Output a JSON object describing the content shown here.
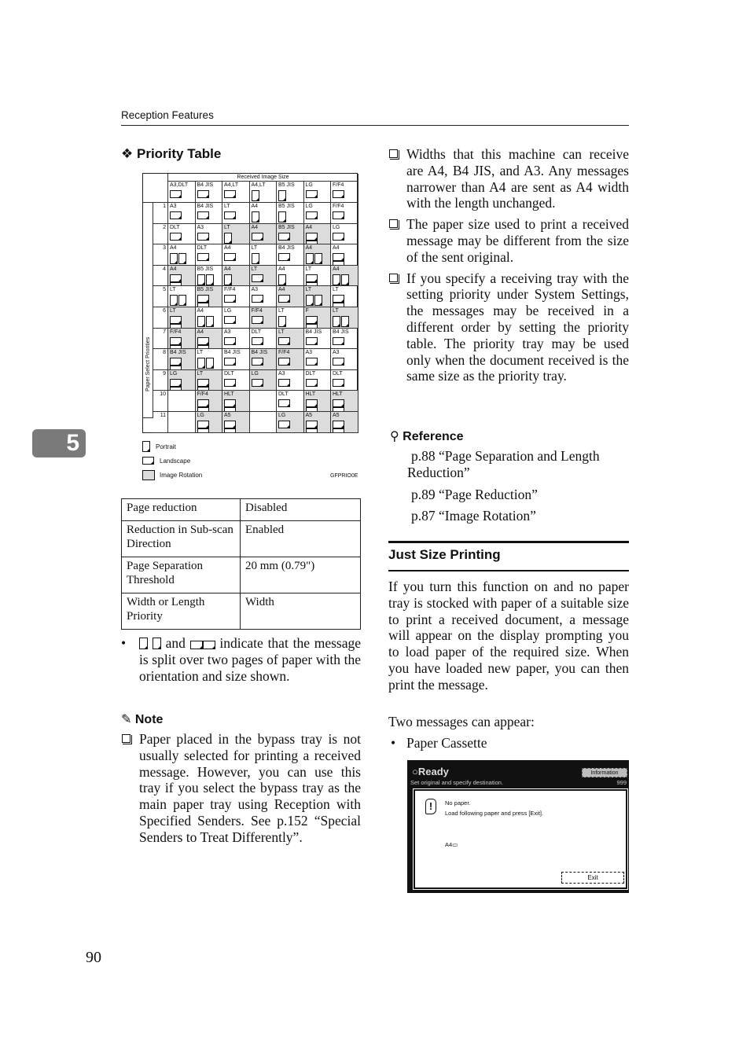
{
  "header": {
    "section_title": "Reception Features"
  },
  "chapter_tab": "5",
  "page_number": "90",
  "priority_table": {
    "heading": "Priority Table",
    "received_image_size_label": "Received Image Size",
    "paper_select_priorities_label": "Paper Select Priorities",
    "columns": [
      "A3,DLT",
      "B4 JIS",
      "A4,LT",
      "A4,LT",
      "B5 JIS",
      "LG",
      "F/F4"
    ],
    "column_icons": [
      "land",
      "land",
      "land",
      "port",
      "port",
      "land",
      "land"
    ],
    "rows": [
      {
        "num": "1",
        "cells": [
          [
            "A3",
            "land",
            1,
            0
          ],
          [
            "B4 JIS",
            "land",
            1,
            0
          ],
          [
            "LT",
            "land",
            1,
            0
          ],
          [
            "A4",
            "port",
            1,
            0
          ],
          [
            "B5 JIS",
            "port",
            1,
            0
          ],
          [
            "LG",
            "land",
            1,
            0
          ],
          [
            "F/F4",
            "land",
            1,
            0
          ]
        ]
      },
      {
        "num": "2",
        "cells": [
          [
            "DLT",
            "land",
            1,
            0
          ],
          [
            "A3",
            "land",
            1,
            0
          ],
          [
            "LT",
            "port",
            1,
            1
          ],
          [
            "A4",
            "land",
            1,
            1
          ],
          [
            "B5 JIS",
            "land",
            1,
            1
          ],
          [
            "A4",
            "land",
            2,
            1
          ],
          [
            "LG",
            "land",
            1,
            0
          ]
        ]
      },
      {
        "num": "3",
        "cells": [
          [
            "A4",
            "port",
            2,
            0
          ],
          [
            "DLT",
            "land",
            1,
            0
          ],
          [
            "A4",
            "land",
            1,
            0
          ],
          [
            "LT",
            "port",
            1,
            0
          ],
          [
            "B4 JIS",
            "land",
            1,
            0
          ],
          [
            "A4",
            "port",
            2,
            1
          ],
          [
            "A4",
            "land",
            2,
            0
          ]
        ]
      },
      {
        "num": "4",
        "cells": [
          [
            "A4",
            "land",
            2,
            1
          ],
          [
            "B5 JIS",
            "port",
            2,
            0
          ],
          [
            "A4",
            "port",
            1,
            1
          ],
          [
            "LT",
            "land",
            1,
            1
          ],
          [
            "A4",
            "port",
            1,
            0
          ],
          [
            "LT",
            "land",
            2,
            0
          ],
          [
            "A4",
            "port",
            2,
            1
          ]
        ]
      },
      {
        "num": "5",
        "cells": [
          [
            "LT",
            "port",
            2,
            0
          ],
          [
            "B5 JIS",
            "land",
            2,
            1
          ],
          [
            "F/F4",
            "land",
            1,
            0
          ],
          [
            "A3",
            "land",
            1,
            0
          ],
          [
            "A4",
            "land",
            1,
            1
          ],
          [
            "LT",
            "port",
            2,
            1
          ],
          [
            "LT",
            "land",
            2,
            0
          ]
        ]
      },
      {
        "num": "6",
        "cells": [
          [
            "LT",
            "land",
            2,
            1
          ],
          [
            "A4",
            "port",
            2,
            0
          ],
          [
            "LG",
            "land",
            1,
            0
          ],
          [
            "F/F4",
            "land",
            1,
            1
          ],
          [
            "LT",
            "port",
            1,
            0
          ],
          [
            "F",
            "land",
            2,
            1
          ],
          [
            "LT",
            "port",
            2,
            1
          ]
        ]
      },
      {
        "num": "7",
        "cells": [
          [
            "F/F4",
            "land",
            2,
            1
          ],
          [
            "A4",
            "land",
            2,
            1
          ],
          [
            "A3",
            "land",
            1,
            0
          ],
          [
            "DLT",
            "land",
            1,
            0
          ],
          [
            "LT",
            "land",
            1,
            1
          ],
          [
            "B4 JIS",
            "land",
            1,
            0
          ],
          [
            "B4 JIS",
            "land",
            1,
            0
          ]
        ]
      },
      {
        "num": "8",
        "cells": [
          [
            "B4 JIS",
            "land",
            2,
            1
          ],
          [
            "LT",
            "port",
            2,
            0
          ],
          [
            "B4 JIS",
            "land",
            1,
            0
          ],
          [
            "B4 JIS",
            "land",
            1,
            1
          ],
          [
            "F/F4",
            "land",
            1,
            1
          ],
          [
            "A3",
            "land",
            1,
            0
          ],
          [
            "A3",
            "land",
            1,
            0
          ]
        ]
      },
      {
        "num": "9",
        "cells": [
          [
            "LG",
            "land",
            2,
            1
          ],
          [
            "LT",
            "land",
            2,
            1
          ],
          [
            "DLT",
            "land",
            1,
            0
          ],
          [
            "LG",
            "land",
            1,
            1
          ],
          [
            "A3",
            "land",
            1,
            0
          ],
          [
            "DLT",
            "land",
            1,
            0
          ],
          [
            "DLT",
            "land",
            1,
            0
          ]
        ]
      },
      {
        "num": "10",
        "cells": [
          [
            "",
            "none",
            0,
            0
          ],
          [
            "F/F4",
            "land",
            2,
            1
          ],
          [
            "HLT",
            "land",
            2,
            1
          ],
          [
            "",
            "none",
            0,
            0
          ],
          [
            "DLT",
            "land",
            1,
            0
          ],
          [
            "HLT",
            "land",
            2,
            1
          ],
          [
            "HLT",
            "land",
            2,
            1
          ]
        ]
      },
      {
        "num": "11",
        "cells": [
          [
            "",
            "none",
            0,
            0
          ],
          [
            "LG",
            "land",
            2,
            1
          ],
          [
            "A5",
            "land",
            2,
            1
          ],
          [
            "",
            "none",
            0,
            0
          ],
          [
            "LG",
            "land",
            1,
            1
          ],
          [
            "A5",
            "land",
            2,
            1
          ],
          [
            "A5",
            "land",
            2,
            1
          ]
        ]
      }
    ],
    "legend": {
      "portrait": "Portrait",
      "landscape": "Landscape",
      "image_rotation": "Image Rotation"
    },
    "figure_id": "GFPRIO0E"
  },
  "settings_table": [
    {
      "setting": "Page reduction",
      "value": "Disabled"
    },
    {
      "setting": "Reduction in Sub-scan Direction",
      "value": "Enabled"
    },
    {
      "setting": "Page Separation Threshold",
      "value": "20 mm (0.79\")"
    },
    {
      "setting": "Width or Length Priority",
      "value": "Width"
    }
  ],
  "split_note": {
    "and": "and",
    "text": "indicate that the message is split over two pages of paper with the orientation and size shown."
  },
  "note": {
    "heading": "Note",
    "items": [
      "Paper placed in the bypass tray is not usually selected for printing a received message. However, you can use this tray if you select the bypass tray as the main paper tray using Reception with Specified Senders. See p.152 “Special Senders to Treat Differently”."
    ]
  },
  "right_notes": [
    "Widths that this machine can receive are A4, B4 JIS, and A3. Any messages narrower than A4 are sent as A4 width with the length unchanged.",
    "The paper size used to print a received message may be different from the size of the sent original.",
    "If you specify a receiving tray with the setting priority under System Settings, the messages may be received in a different order by setting the priority table. The priority tray may be used only when the document received is the same size as the priority tray."
  ],
  "reference": {
    "heading": "Reference",
    "links": [
      "p.88 “Page Separation and Length Reduction”",
      "p.89 “Page Reduction”",
      "p.87 “Image Rotation”"
    ]
  },
  "just_size_printing": {
    "heading": "Just Size Printing",
    "body": "If you turn this function on and no paper tray is stocked with paper of a suitable size to print a received document, a message will appear on the display prompting you to load paper of the required size. When you have loaded new paper, you can then print the message.",
    "two_messages": "Two messages can appear:",
    "bullet": "Paper Cassette"
  },
  "device_screen": {
    "status": "○Ready",
    "info_button": "Information",
    "subtitle": "Set original and specify destination.",
    "count": "999",
    "line1": "No paper.",
    "line2": "Load following paper and press [Exit].",
    "paper": "A4▭",
    "exit_button": "Exit"
  }
}
